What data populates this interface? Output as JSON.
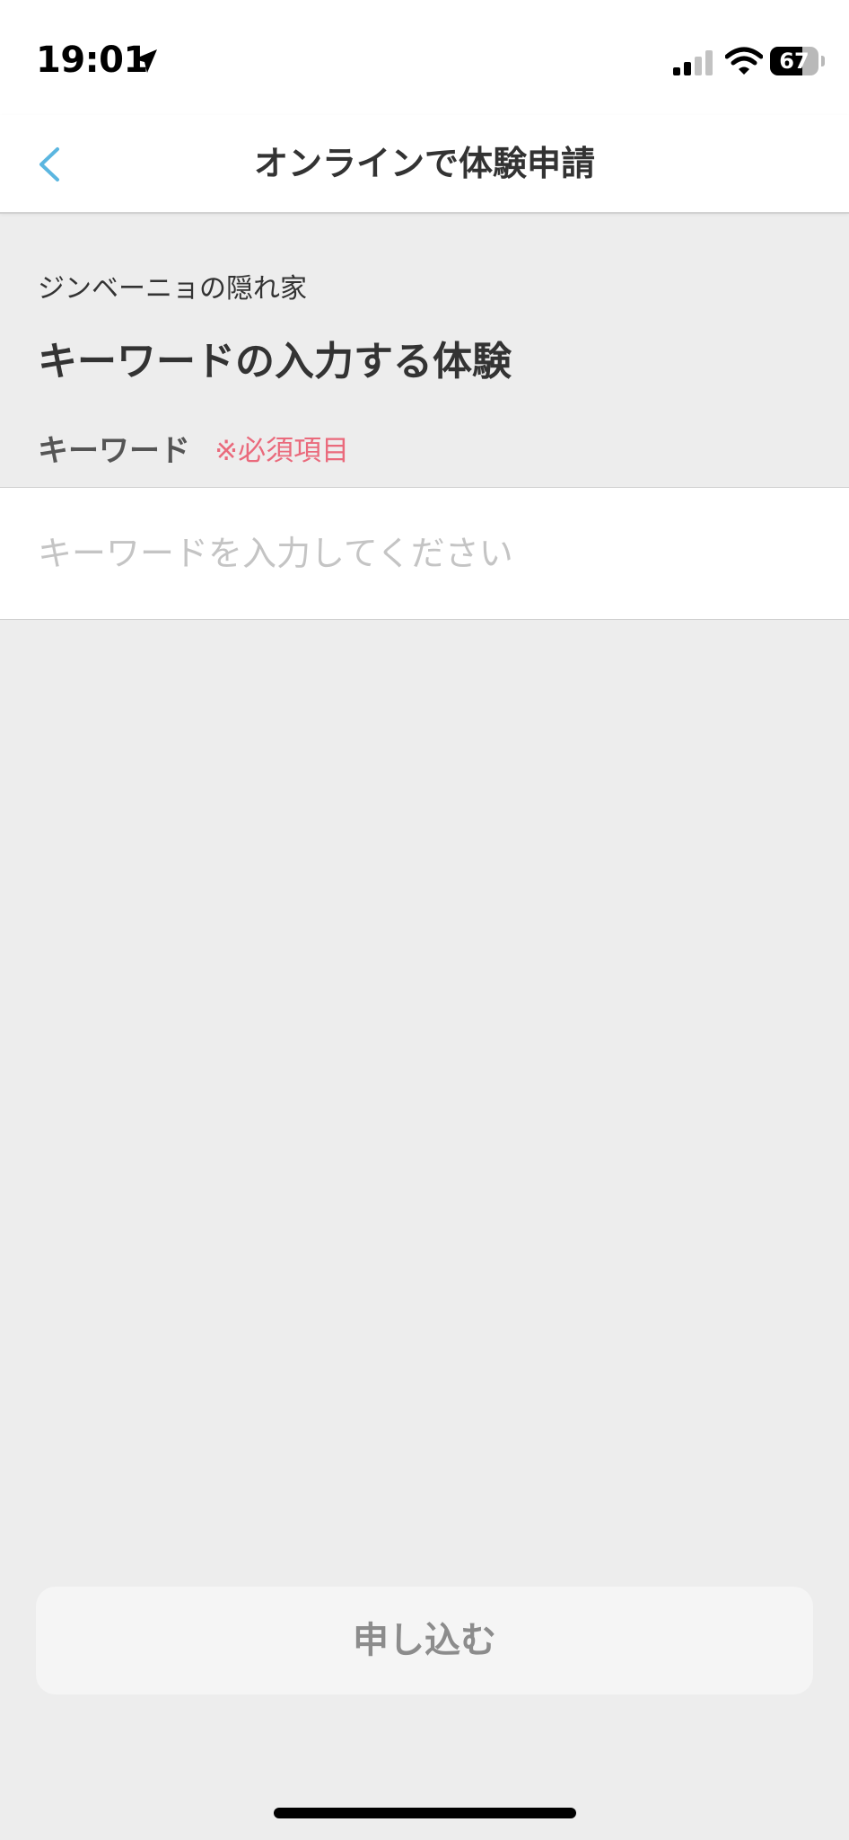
{
  "status_bar": {
    "time": "19:01",
    "battery_level": "67",
    "battery_fraction": 0.67,
    "icons": [
      "location-arrow-icon",
      "cellular-signal-icon",
      "wifi-icon",
      "battery-icon"
    ]
  },
  "nav": {
    "back_icon": "chevron-left-icon",
    "title": "オンラインで体験申請"
  },
  "experience": {
    "shop_name": "ジンベーニョの隠れ家",
    "title": "キーワードの入力する体験"
  },
  "form": {
    "keyword_label": "キーワード",
    "required_text": "※必須項目",
    "keyword_value": "",
    "keyword_placeholder": "キーワードを入力してください"
  },
  "submit": {
    "label": "申し込む"
  },
  "colors": {
    "accent_back": "#5bb6e0",
    "required": "#ea6a7c",
    "background": "#ededed",
    "surface": "#ffffff"
  }
}
